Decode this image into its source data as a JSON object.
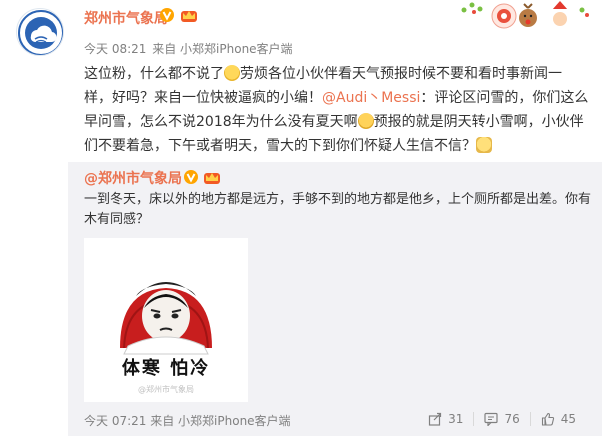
{
  "colors": {
    "accent": "#eb7350",
    "meta": "#808080",
    "repost_bg": "#f2f2f5",
    "verified": "#ffa500"
  },
  "post": {
    "author": "郑州市气象局",
    "time": "今天 08:21",
    "source": "来自 小郑郑iPhone客户端",
    "text": {
      "p1": "这位粉，什么都不说了",
      "p2": "劳烦各位小伙伴看天气预报时候不要和看时事新闻一样，好吗？来自一位快被逼疯的小编！",
      "mention1": "@Audi丶Messi",
      "p3": "：评论区问雪的，你们这么早问雪，怎么不说2018年为什么没有夏天啊",
      "p4": "预报的就是阴天转小雪啊，小伙伴们不要着急，下午或者明天，雪大的下到你们怀疑人生信不信？"
    },
    "icons": {
      "verified": "verified-v-icon",
      "level": "member-crown-icon",
      "decoration": "christmas-decoration-icon"
    }
  },
  "repost": {
    "author": "@郑州市气象局",
    "text": "一到冬天，床以外的地方都是远方，手够不到的地方都是他乡，上个厕所都是出差。你有木有同感？",
    "image_caption": "体寒 怕冷",
    "image_watermark": "@郑州市气象局",
    "time": "今天 07:21",
    "source": "来自 小郑郑iPhone客户端",
    "actions": [
      {
        "name": "share",
        "count": "31"
      },
      {
        "name": "comment",
        "count": "76"
      },
      {
        "name": "like",
        "count": "45"
      }
    ]
  }
}
